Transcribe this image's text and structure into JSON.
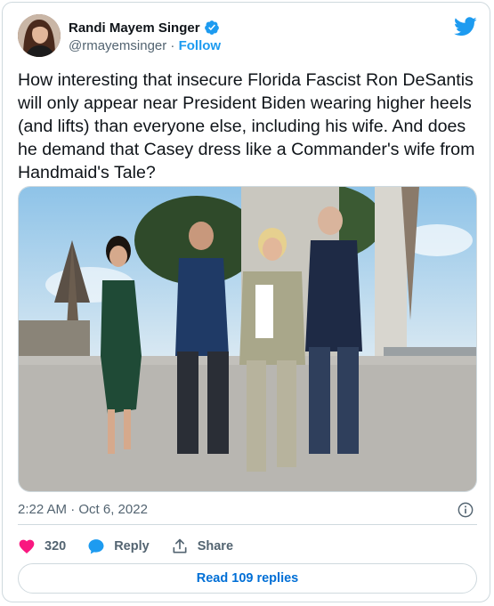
{
  "author": {
    "name": "Randi Mayem Singer",
    "handle": "@rmayemsinger",
    "separator": " · ",
    "follow_label": "Follow"
  },
  "tweet": {
    "text": "How interesting that insecure Florida Fascist Ron DeSantis will only appear near President Biden wearing higher heels (and lifts) than everyone else, including his wife. And does he demand that Casey dress like a Commander's wife from Handmaid's Tale?",
    "timestamp": "2:22 AM · Oct 6, 2022"
  },
  "actions": {
    "like_count": "320",
    "reply_label": "Reply",
    "share_label": "Share"
  },
  "read_replies_label": "Read 109 replies",
  "icons": {
    "verified": "verified-badge-icon",
    "twitter": "twitter-bird-icon",
    "info": "info-icon",
    "like": "heart-icon",
    "reply": "reply-bubble-icon",
    "share": "share-icon"
  },
  "colors": {
    "accent": "#1d9bf0",
    "like": "#f91880",
    "text": "#0f1419",
    "muted": "#536471",
    "border": "#cfd9de",
    "link": "#006fd6"
  }
}
